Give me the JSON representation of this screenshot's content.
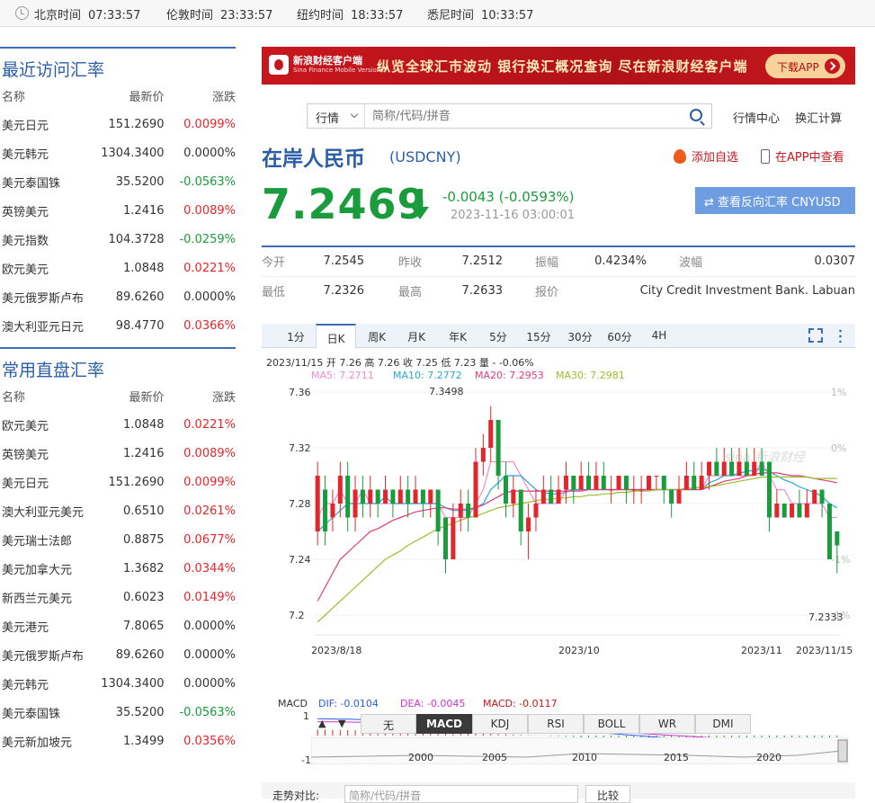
{
  "topbar": {
    "zones": [
      {
        "city": "北京时间",
        "time": "07:33:57"
      },
      {
        "city": "伦敦时间",
        "time": "23:33:57"
      },
      {
        "city": "纽约时间",
        "time": "18:33:57"
      },
      {
        "city": "悉尼时间",
        "time": "10:33:57"
      }
    ]
  },
  "recent": {
    "title": "最近访问汇率",
    "headers": [
      "名称",
      "最新价",
      "涨跌"
    ],
    "rows": [
      {
        "name": "美元日元",
        "price": "151.2690",
        "chg": "0.0099%",
        "dir": "up"
      },
      {
        "name": "美元韩元",
        "price": "1304.3400",
        "chg": "0.0000%",
        "dir": "zero"
      },
      {
        "name": "美元泰国铢",
        "price": "35.5200",
        "chg": "-0.0563%",
        "dir": "dn"
      },
      {
        "name": "英镑美元",
        "price": "1.2416",
        "chg": "0.0089%",
        "dir": "up"
      },
      {
        "name": "美元指数",
        "price": "104.3728",
        "chg": "-0.0259%",
        "dir": "dn"
      },
      {
        "name": "欧元美元",
        "price": "1.0848",
        "chg": "0.0221%",
        "dir": "up"
      },
      {
        "name": "美元俄罗斯卢布",
        "price": "89.6260",
        "chg": "0.0000%",
        "dir": "zero"
      },
      {
        "name": "澳大利亚元日元",
        "price": "98.4770",
        "chg": "0.0366%",
        "dir": "up"
      }
    ]
  },
  "direct": {
    "title": "常用直盘汇率",
    "headers": [
      "名称",
      "最新价",
      "涨跌"
    ],
    "rows": [
      {
        "name": "欧元美元",
        "price": "1.0848",
        "chg": "0.0221%",
        "dir": "up"
      },
      {
        "name": "英镑美元",
        "price": "1.2416",
        "chg": "0.0089%",
        "dir": "up"
      },
      {
        "name": "美元日元",
        "price": "151.2690",
        "chg": "0.0099%",
        "dir": "up"
      },
      {
        "name": "澳大利亚元美元",
        "price": "0.6510",
        "chg": "0.0261%",
        "dir": "up"
      },
      {
        "name": "美元瑞士法郎",
        "price": "0.8875",
        "chg": "0.0677%",
        "dir": "up"
      },
      {
        "name": "美元加拿大元",
        "price": "1.3682",
        "chg": "0.0344%",
        "dir": "up"
      },
      {
        "name": "新西兰元美元",
        "price": "0.6023",
        "chg": "0.0149%",
        "dir": "up"
      },
      {
        "name": "美元港元",
        "price": "7.8065",
        "chg": "0.0000%",
        "dir": "zero"
      },
      {
        "name": "美元俄罗斯卢布",
        "price": "89.6260",
        "chg": "0.0000%",
        "dir": "zero"
      },
      {
        "name": "美元韩元",
        "price": "1304.3400",
        "chg": "0.0000%",
        "dir": "zero"
      },
      {
        "name": "美元泰国铢",
        "price": "35.5200",
        "chg": "-0.0563%",
        "dir": "dn"
      },
      {
        "name": "美元新加坡元",
        "price": "1.3499",
        "chg": "0.0356%",
        "dir": "up"
      }
    ]
  },
  "banner": {
    "logo_title": "新浪财经客户端",
    "logo_sub": "Sina Finance Mobile Version",
    "slogan": "纵览全球汇市波动 银行换汇概况查询 尽在新浪财经客户端",
    "download": "下载APP"
  },
  "search": {
    "select": "行情",
    "placeholder": "简称/代码/拼音"
  },
  "links": [
    "行情中心",
    "换汇计算"
  ],
  "quote": {
    "name": "在岸人民币",
    "code": "(USDCNY)",
    "fav": "添加自选",
    "app": "在APP中查看",
    "price": "7.2469",
    "change": "-0.0043 (-0.0593%)",
    "time": "2023-11-16 03:00:01",
    "reverse": "查看反向汇率 CNYUSD"
  },
  "stats": [
    [
      {
        "l": "今开",
        "v": "7.2545"
      },
      {
        "l": "昨收",
        "v": "7.2512"
      },
      {
        "l": "振幅",
        "v": "0.4234%"
      },
      {
        "l": "波幅",
        "v": "0.0307"
      }
    ],
    [
      {
        "l": "最低",
        "v": "7.2326"
      },
      {
        "l": "最高",
        "v": "7.2633"
      },
      {
        "l": "报价",
        "v": "City Credit Investment Bank. Labuan"
      }
    ]
  ],
  "tabs": [
    "1分",
    "日K",
    "周K",
    "月K",
    "年K",
    "5分",
    "15分",
    "30分",
    "60分",
    "4H"
  ],
  "chart_info": {
    "ohlc": "2023/11/15 开 7.26 高 7.26 收 7.25 低 7.23 量 - -0.06%",
    "ma5": "MA5: 7.2711",
    "ma10": "MA10: 7.2772",
    "ma20": "MA20: 7.2953",
    "ma30": "MA30: 7.2981",
    "colors": {
      "ma5": "#f08ad0",
      "ma10": "#2aa6d6",
      "ma20": "#e33a7a",
      "ma30": "#9bbd2a",
      "up": "#e3262c",
      "dn": "#1a9b3c"
    },
    "max_label": "7.3498",
    "min_label": "7.2333",
    "macd": {
      "label": "MACD",
      "dif": "DIF: -0.0104",
      "dea": "DEA: -0.0045",
      "macd": "MACD: -0.0117",
      "top": "1",
      "bot": "-1"
    },
    "indicators": [
      "无",
      "MACD",
      "KDJ",
      "RSI",
      "BOLL",
      "WR",
      "DMI"
    ],
    "nav_up": "▲",
    "nav_down": "▼",
    "timeline_years": [
      "2000",
      "2005",
      "2010",
      "2015",
      "2020"
    ],
    "compare_label": "走势对比:",
    "compare_placeholder": "简称/代码/拼音",
    "compare_button": "比较"
  },
  "chart_data": {
    "type": "candlestick",
    "y_ticks": [
      "7.36",
      "7.32",
      "7.28",
      "7.24",
      "7.2"
    ],
    "pct_ticks": [
      "1%",
      "0%",
      "-1%",
      "-1%"
    ],
    "ylim": [
      7.2,
      7.36
    ],
    "x_labels": [
      "2023/8/18",
      "2023/10",
      "2023/11",
      "2023/11/15"
    ],
    "candles": [
      [
        7.26,
        7.3,
        7.25,
        7.31
      ],
      [
        7.29,
        7.26,
        7.25,
        7.3
      ],
      [
        7.27,
        7.28,
        7.26,
        7.29
      ],
      [
        7.28,
        7.3,
        7.27,
        7.31
      ],
      [
        7.3,
        7.27,
        7.26,
        7.31
      ],
      [
        7.27,
        7.29,
        7.26,
        7.3
      ],
      [
        7.29,
        7.28,
        7.27,
        7.3
      ],
      [
        7.28,
        7.29,
        7.27,
        7.3
      ],
      [
        7.29,
        7.28,
        7.27,
        7.29
      ],
      [
        7.28,
        7.29,
        7.28,
        7.3
      ],
      [
        7.29,
        7.28,
        7.27,
        7.29
      ],
      [
        7.28,
        7.29,
        7.28,
        7.3
      ],
      [
        7.29,
        7.28,
        7.27,
        7.3
      ],
      [
        7.28,
        7.29,
        7.28,
        7.3
      ],
      [
        7.29,
        7.28,
        7.27,
        7.29
      ],
      [
        7.28,
        7.29,
        7.27,
        7.29
      ],
      [
        7.29,
        7.26,
        7.25,
        7.29
      ],
      [
        7.27,
        7.24,
        7.23,
        7.27
      ],
      [
        7.24,
        7.27,
        7.24,
        7.28
      ],
      [
        7.27,
        7.28,
        7.26,
        7.29
      ],
      [
        7.28,
        7.27,
        7.26,
        7.29
      ],
      [
        7.27,
        7.31,
        7.27,
        7.32
      ],
      [
        7.31,
        7.32,
        7.3,
        7.33
      ],
      [
        7.32,
        7.34,
        7.31,
        7.35
      ],
      [
        7.34,
        7.3,
        7.29,
        7.34
      ],
      [
        7.3,
        7.28,
        7.27,
        7.31
      ],
      [
        7.28,
        7.29,
        7.27,
        7.3
      ],
      [
        7.29,
        7.26,
        7.25,
        7.29
      ],
      [
        7.26,
        7.27,
        7.24,
        7.28
      ],
      [
        7.27,
        7.28,
        7.26,
        7.29
      ],
      [
        7.28,
        7.29,
        7.28,
        7.3
      ],
      [
        7.29,
        7.28,
        7.28,
        7.3
      ],
      [
        7.28,
        7.29,
        7.28,
        7.3
      ],
      [
        7.29,
        7.3,
        7.28,
        7.31
      ],
      [
        7.3,
        7.29,
        7.28,
        7.3
      ],
      [
        7.29,
        7.3,
        7.29,
        7.31
      ],
      [
        7.3,
        7.29,
        7.29,
        7.31
      ],
      [
        7.29,
        7.3,
        7.29,
        7.31
      ],
      [
        7.3,
        7.29,
        7.29,
        7.31
      ],
      [
        7.29,
        7.29,
        7.28,
        7.3
      ],
      [
        7.29,
        7.3,
        7.29,
        7.3
      ],
      [
        7.3,
        7.29,
        7.28,
        7.3
      ],
      [
        7.29,
        7.29,
        7.28,
        7.3
      ],
      [
        7.29,
        7.29,
        7.28,
        7.3
      ],
      [
        7.29,
        7.3,
        7.29,
        7.3
      ],
      [
        7.3,
        7.3,
        7.29,
        7.3
      ],
      [
        7.3,
        7.29,
        7.28,
        7.3
      ],
      [
        7.29,
        7.28,
        7.27,
        7.29
      ],
      [
        7.28,
        7.29,
        7.28,
        7.3
      ],
      [
        7.29,
        7.3,
        7.29,
        7.31
      ],
      [
        7.3,
        7.29,
        7.29,
        7.31
      ],
      [
        7.29,
        7.3,
        7.29,
        7.31
      ],
      [
        7.3,
        7.31,
        7.29,
        7.31
      ],
      [
        7.31,
        7.3,
        7.3,
        7.32
      ],
      [
        7.3,
        7.31,
        7.3,
        7.32
      ],
      [
        7.31,
        7.3,
        7.3,
        7.32
      ],
      [
        7.3,
        7.31,
        7.3,
        7.32
      ],
      [
        7.31,
        7.3,
        7.3,
        7.32
      ],
      [
        7.3,
        7.31,
        7.3,
        7.32
      ],
      [
        7.31,
        7.3,
        7.3,
        7.32
      ],
      [
        7.31,
        7.27,
        7.26,
        7.31
      ],
      [
        7.27,
        7.28,
        7.27,
        7.29
      ],
      [
        7.28,
        7.27,
        7.27,
        7.28
      ],
      [
        7.27,
        7.28,
        7.27,
        7.28
      ],
      [
        7.28,
        7.27,
        7.27,
        7.29
      ],
      [
        7.27,
        7.28,
        7.27,
        7.29
      ],
      [
        7.28,
        7.29,
        7.28,
        7.29
      ],
      [
        7.29,
        7.28,
        7.27,
        7.29
      ],
      [
        7.28,
        7.24,
        7.24,
        7.28
      ],
      [
        7.26,
        7.25,
        7.23,
        7.26
      ]
    ],
    "ma": {
      "ma5": [
        7.27,
        7.28,
        7.28,
        7.29,
        7.28,
        7.28,
        7.29,
        7.28,
        7.28,
        7.28,
        7.28,
        7.28,
        7.28,
        7.28,
        7.28,
        7.28,
        7.28,
        7.27,
        7.27,
        7.27,
        7.27,
        7.28,
        7.29,
        7.31,
        7.31,
        7.31,
        7.31,
        7.3,
        7.29,
        7.28,
        7.28,
        7.28,
        7.28,
        7.29,
        7.29,
        7.29,
        7.29,
        7.29,
        7.29,
        7.29,
        7.29,
        7.29,
        7.29,
        7.29,
        7.29,
        7.29,
        7.29,
        7.29,
        7.29,
        7.29,
        7.29,
        7.29,
        7.3,
        7.3,
        7.3,
        7.3,
        7.3,
        7.3,
        7.3,
        7.31,
        7.3,
        7.29,
        7.29,
        7.28,
        7.28,
        7.28,
        7.28,
        7.28,
        7.27,
        7.27
      ],
      "ma10": [
        7.26,
        7.265,
        7.27,
        7.275,
        7.28,
        7.28,
        7.28,
        7.28,
        7.28,
        7.285,
        7.28,
        7.28,
        7.28,
        7.28,
        7.28,
        7.28,
        7.28,
        7.277,
        7.275,
        7.275,
        7.275,
        7.277,
        7.28,
        7.29,
        7.295,
        7.3,
        7.3,
        7.3,
        7.295,
        7.29,
        7.288,
        7.287,
        7.287,
        7.288,
        7.29,
        7.29,
        7.29,
        7.29,
        7.29,
        7.29,
        7.29,
        7.29,
        7.29,
        7.29,
        7.29,
        7.29,
        7.29,
        7.29,
        7.29,
        7.29,
        7.29,
        7.29,
        7.295,
        7.297,
        7.3,
        7.3,
        7.302,
        7.303,
        7.304,
        7.305,
        7.303,
        7.3,
        7.297,
        7.295,
        7.292,
        7.29,
        7.288,
        7.285,
        7.28,
        7.277
      ],
      "ma20": [
        7.21,
        7.22,
        7.23,
        7.24,
        7.245,
        7.25,
        7.255,
        7.26,
        7.262,
        7.265,
        7.268,
        7.27,
        7.272,
        7.274,
        7.275,
        7.276,
        7.277,
        7.277,
        7.276,
        7.276,
        7.276,
        7.277,
        7.279,
        7.282,
        7.285,
        7.288,
        7.289,
        7.289,
        7.289,
        7.289,
        7.289,
        7.289,
        7.289,
        7.289,
        7.289,
        7.289,
        7.29,
        7.29,
        7.29,
        7.29,
        7.29,
        7.29,
        7.29,
        7.29,
        7.29,
        7.29,
        7.29,
        7.29,
        7.29,
        7.29,
        7.29,
        7.29,
        7.292,
        7.294,
        7.296,
        7.297,
        7.298,
        7.3,
        7.301,
        7.302,
        7.302,
        7.302,
        7.301,
        7.3,
        7.3,
        7.299,
        7.298,
        7.297,
        7.296,
        7.295
      ],
      "ma30": [
        7.195,
        7.2,
        7.205,
        7.21,
        7.215,
        7.22,
        7.225,
        7.23,
        7.235,
        7.24,
        7.243,
        7.246,
        7.25,
        7.253,
        7.256,
        7.259,
        7.262,
        7.264,
        7.266,
        7.268,
        7.27,
        7.271,
        7.273,
        7.275,
        7.277,
        7.278,
        7.279,
        7.28,
        7.281,
        7.282,
        7.283,
        7.283,
        7.284,
        7.284,
        7.285,
        7.285,
        7.286,
        7.286,
        7.287,
        7.287,
        7.288,
        7.288,
        7.289,
        7.289,
        7.289,
        7.29,
        7.29,
        7.29,
        7.29,
        7.291,
        7.291,
        7.292,
        7.292,
        7.293,
        7.294,
        7.295,
        7.296,
        7.297,
        7.298,
        7.299,
        7.299,
        7.299,
        7.299,
        7.299,
        7.299,
        7.299,
        7.298,
        7.298,
        7.298,
        7.298
      ]
    }
  }
}
